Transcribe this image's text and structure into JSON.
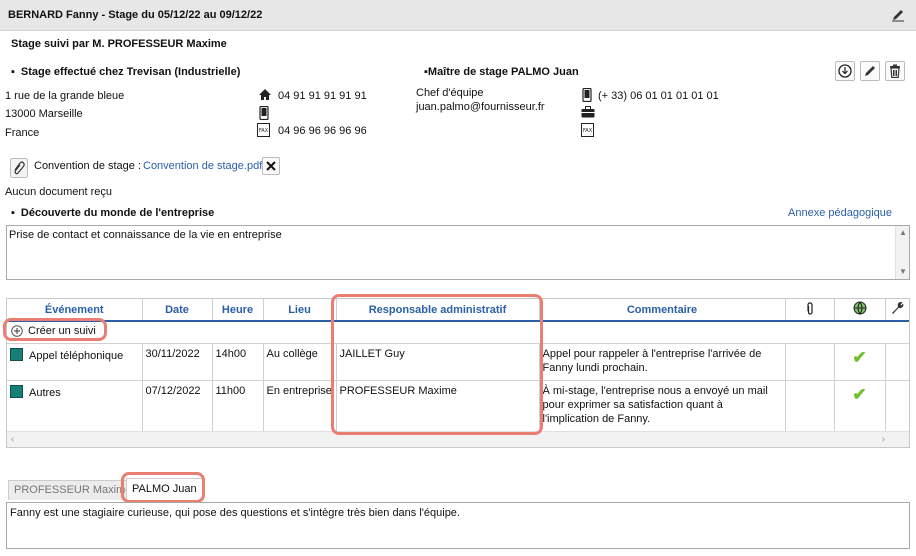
{
  "header": {
    "title": "BERNARD Fanny - Stage du 05/12/22 au 09/12/22"
  },
  "supervision": {
    "text": "Stage suivi par M. PROFESSEUR Maxime"
  },
  "company": {
    "heading": "Stage effectué chez Trevisan (Industrielle)",
    "address_line1": "1 rue de la grande bleue",
    "address_line2": "13000 Marseille",
    "country": "France",
    "phone": "04 91 91 91 91 91",
    "mobile": "",
    "fax": "04 96 96 96 96 96"
  },
  "mentor": {
    "heading": "Maître de stage PALMO Juan",
    "role": "Chef d'équipe",
    "email": "juan.palmo@fournisseur.fr",
    "mobile": "(+ 33) 06 01 01 01 01 01",
    "work_phone": "",
    "fax": ""
  },
  "convention": {
    "label": "Convention de stage :",
    "file_link": "Convention de stage.pdf",
    "no_docs": "Aucun document reçu"
  },
  "discovery": {
    "heading": "Découverte du monde de l'entreprise",
    "annex_link": "Annexe pédagogique",
    "text": "Prise de contact et connaissance de la vie en entreprise"
  },
  "events_table": {
    "columns": {
      "event": "Événement",
      "date": "Date",
      "hour": "Heure",
      "place": "Lieu",
      "admin": "Responsable administratif",
      "comment": "Commentaire"
    },
    "create_label": "Créer un suivi",
    "rows": [
      {
        "event": "Appel téléphonique",
        "date": "30/11/2022",
        "hour": "14h00",
        "place": "Au collège",
        "admin": "JAILLET Guy",
        "comment": "Appel pour rappeler à l'entreprise l'arrivée de Fanny lundi prochain.",
        "published": true
      },
      {
        "event": "Autres",
        "date": "07/12/2022",
        "hour": "11h00",
        "place": "En entreprise",
        "admin": "PROFESSEUR Maxime",
        "comment": "À mi-stage, l'entreprise nous a envoyé un mail pour exprimer sa satisfaction quant à l'implication de Fanny.",
        "published": true
      }
    ]
  },
  "tabs": [
    {
      "label": "PROFESSEUR Maxime",
      "active": false
    },
    {
      "label": "PALMO Juan",
      "active": true
    }
  ],
  "appreciation": {
    "text": "Fanny est une stagiaire curieuse, qui pose des questions et s'intègre très bien dans l'équipe."
  },
  "colors": {
    "accent": "#2a5fa8",
    "highlight": "#ea7e72",
    "event_type": "#167e77",
    "check": "#6fbf2a"
  }
}
